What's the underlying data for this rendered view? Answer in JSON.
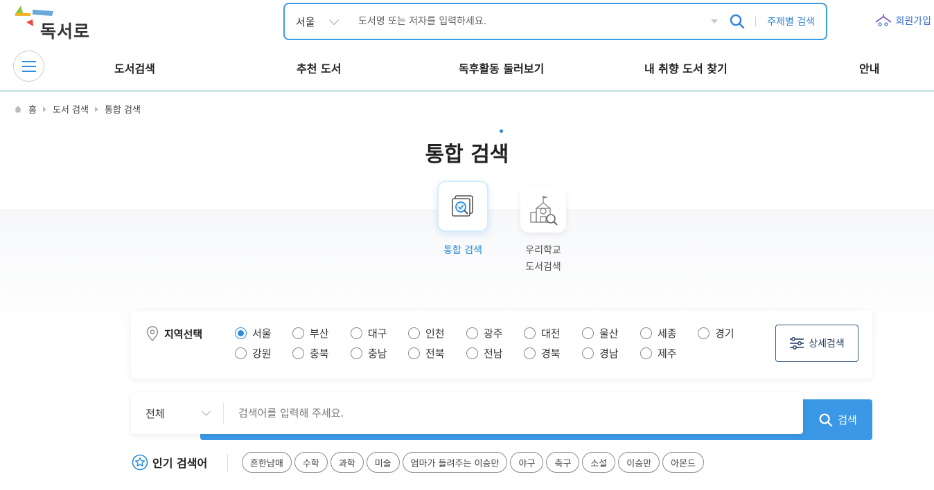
{
  "header": {
    "logo_text": "독서로",
    "search": {
      "region": "서울",
      "placeholder": "도서명 또는 저자를 입력하세요.",
      "topic_link": "주제별 검색"
    },
    "join_label": "회원가입"
  },
  "nav": {
    "items": [
      "도서검색",
      "추천 도서",
      "독후활동 둘러보기",
      "내 취향 도서 찾기",
      "안내"
    ]
  },
  "breadcrumb": [
    "홈",
    "도서 검색",
    "통합 검색"
  ],
  "page_title": "통합 검색",
  "tabs": [
    {
      "label": "통합 검색",
      "active": true
    },
    {
      "label_line1": "우리학교",
      "label_line2": "도서검색",
      "active": false
    }
  ],
  "region": {
    "title": "지역선택",
    "options": [
      "서울",
      "부산",
      "대구",
      "인천",
      "광주",
      "대전",
      "울산",
      "세종",
      "경기",
      "강원",
      "충북",
      "충남",
      "전북",
      "전남",
      "경북",
      "경남",
      "제주"
    ],
    "selected": "서울",
    "detail_button": "상세검색"
  },
  "main_search": {
    "scope": "전체",
    "placeholder": "검색어를 입력해 주세요.",
    "button": "검색"
  },
  "popular": {
    "title": "인기 검색어",
    "tags": [
      "흔한남매",
      "수학",
      "과학",
      "미술",
      "엄마가 들려주는 이승만",
      "야구",
      "축구",
      "소설",
      "이승만",
      "아몬드"
    ]
  },
  "colors": {
    "accent": "#3b98e6",
    "link": "#2f86d6",
    "nav_border": "#4aa6a6"
  }
}
